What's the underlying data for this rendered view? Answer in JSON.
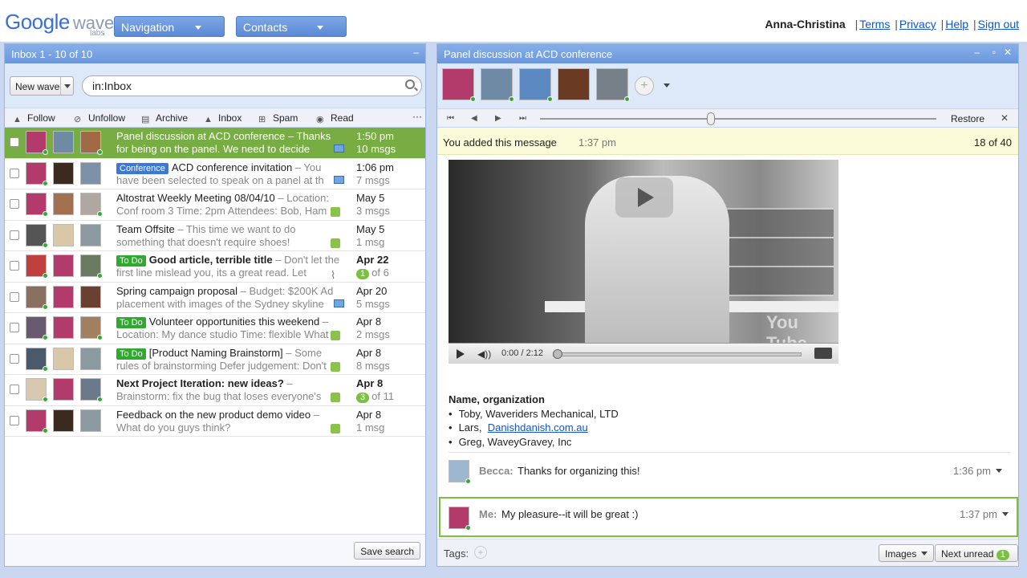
{
  "logo": {
    "google": "Google",
    "wave": "wave",
    "labs": "labs"
  },
  "nav": {
    "navigation": "Navigation",
    "contacts": "Contacts"
  },
  "toplinks": {
    "user": "Anna-Christina",
    "terms": "Terms",
    "privacy": "Privacy",
    "help": "Help",
    "signout": "Sign out"
  },
  "inbox": {
    "title": "Inbox 1 - 10 of 10",
    "new_wave": "New wave",
    "search_value": "in:Inbox",
    "actions": [
      "Follow",
      "Unfollow",
      "Archive",
      "Inbox",
      "Spam",
      "Read"
    ],
    "more": "···",
    "save_search": "Save search",
    "rows": [
      {
        "tag": "",
        "title": "Panel discussion at ACD conference",
        "snippet": " – Thanks for being on the panel. We need to decide",
        "date": "1:50 pm",
        "meta": "10 msgs",
        "bold": false,
        "selected": true,
        "badge": ""
      },
      {
        "tag": "Conference",
        "tagcolor": "blue",
        "title": "ACD conference invitation",
        "snippet": " – You have been selected to speak on a panel at th",
        "date": "1:06 pm",
        "meta": "7 msgs",
        "bold": false,
        "selected": false,
        "badge": ""
      },
      {
        "tag": "",
        "title": "Altostrat Weekly Meeting 08/04/10",
        "snippet": " – Location: Conf room 3 Time: 2pm Attendees: Bob, Ham",
        "date": "May 5",
        "meta": "3 msgs",
        "bold": false,
        "selected": false,
        "badge": ""
      },
      {
        "tag": "",
        "title": "Team Offsite",
        "snippet": " – This time we want to do something that doesn't require shoes!",
        "date": "May 5",
        "meta": "1 msg",
        "bold": false,
        "selected": false,
        "badge": ""
      },
      {
        "tag": "To Do",
        "tagcolor": "green",
        "title": "Good article, terrible title",
        "snippet": " – Don't let the first line mislead you, its a great read. Let",
        "date": "Apr 22",
        "meta": "of 6",
        "bold": true,
        "selected": false,
        "badge": "1"
      },
      {
        "tag": "",
        "title": "Spring campaign proposal",
        "snippet": " – Budget: $200K Ad placement with images of the Sydney skyline",
        "date": "Apr 20",
        "meta": "5 msgs",
        "bold": false,
        "selected": false,
        "badge": ""
      },
      {
        "tag": "To Do",
        "tagcolor": "green",
        "title": "Volunteer opportunities this weekend",
        "snippet": " – Location: My dance studio Time: flexible What",
        "date": "Apr 8",
        "meta": "2 msgs",
        "bold": false,
        "selected": false,
        "badge": ""
      },
      {
        "tag": "To Do",
        "tagcolor": "green",
        "title": "[Product Naming Brainstorm]",
        "snippet": " – Some rules of brainstorming Defer judgement: Don't",
        "date": "Apr 8",
        "meta": "8 msgs",
        "bold": false,
        "selected": false,
        "badge": ""
      },
      {
        "tag": "",
        "title": "Next Project Iteration: new ideas?",
        "snippet": " – Brainstorm: fix the bug that loses everyone's",
        "date": "Apr 8",
        "meta": "of 11",
        "bold": true,
        "selected": false,
        "badge": "3"
      },
      {
        "tag": "",
        "title": "Feedback on the new product demo video",
        "snippet": " – What do you guys think?",
        "date": "Apr 8",
        "meta": "1 msg",
        "bold": false,
        "selected": false,
        "badge": ""
      }
    ]
  },
  "wave": {
    "title": "Panel discussion at ACD conference",
    "restore": "Restore",
    "added_label": "You added this message",
    "added_time": "1:37 pm",
    "position": "18 of 40",
    "video_time": "0:00 / 2:12",
    "youtube": "You Tube",
    "org_heading": "Name, organization",
    "org_items": [
      {
        "pre": "Toby, Waveriders Mechanical, LTD",
        "link": ""
      },
      {
        "pre": "Lars, ",
        "link": "Danishdanish.com.au"
      },
      {
        "pre": "Greg, WaveyGravey, Inc",
        "link": ""
      }
    ],
    "blips": [
      {
        "who": "Becca:",
        "msg": "Thanks for organizing this!",
        "time": "1:36 pm"
      },
      {
        "who": "Me:",
        "msg": "My pleasure--it will be great :)",
        "time": "1:37 pm"
      }
    ],
    "tags_label": "Tags:",
    "images_btn": "Images",
    "next_unread": "Next unread",
    "unread_count": "1"
  }
}
